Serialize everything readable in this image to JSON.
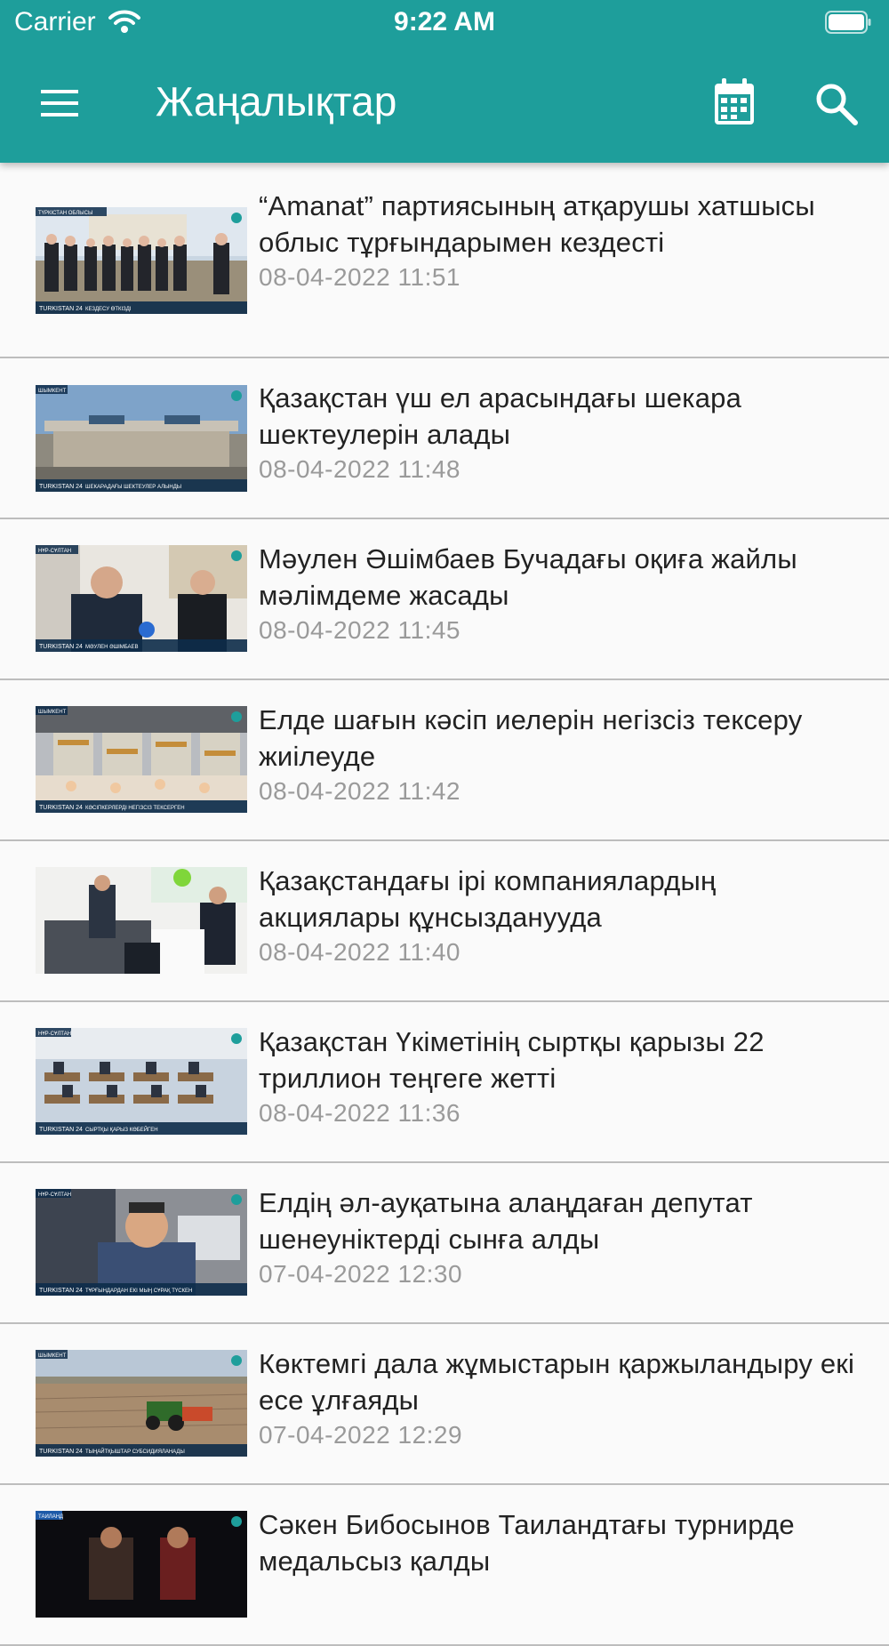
{
  "status_bar": {
    "carrier": "Carrier",
    "time": "9:22 AM"
  },
  "toolbar": {
    "title": "Жаңалықтар"
  },
  "colors": {
    "appbar": "#1e9e9b",
    "date": "#9a9a9a",
    "divider": "#bdbdbd"
  },
  "news": [
    {
      "title": "“Amanat” партиясының атқарушы хатшысы облыс тұрғындарымен кездесті",
      "date": "08-04-2022 11:51",
      "thumb_caption": "КЕЗДЕСУ ӨТКІЗДІ",
      "thumb_tag": "ТҮРКІСТАН ОБЛЫСЫ",
      "thumb_brand": "TURKISTAN 24"
    },
    {
      "title": "Қазақстан үш ел арасындағы шекара шектеулерін алады",
      "date": "08-04-2022 11:48",
      "thumb_caption": "ШЕКАРАДАҒЫ ШЕКТЕУЛЕР АЛЫНДЫ",
      "thumb_tag": "ШЫМКЕНТ",
      "thumb_brand": "TURKISTAN 24"
    },
    {
      "title": "Мәулен Әшімбаев Бучадағы оқиға жайлы мәлімдеме жасады",
      "date": "08-04-2022 11:45",
      "thumb_caption": "МӘУЛЕН ӘШІМБАЕВ",
      "thumb_tag": "НҰР-СҰЛТАН",
      "thumb_brand": "TURKISTAN 24"
    },
    {
      "title": "Елде шағын кәсіп иелерін негізсіз тексеру жиілеуде",
      "date": "08-04-2022 11:42",
      "thumb_caption": "КӘСІПКЕРЛЕРДІ НЕГІЗСІЗ ТЕКСЕРГЕН",
      "thumb_tag": "ШЫМКЕНТ",
      "thumb_brand": "TURKISTAN 24"
    },
    {
      "title": "Қазақстандағы ірі компаниялардың акциялары құнсызданууда",
      "date": "08-04-2022 11:40",
      "thumb_caption": "",
      "thumb_tag": "",
      "thumb_brand": ""
    },
    {
      "title": "Қазақстан Үкіметінің сыртқы қарызы 22 триллион теңгеге жетті",
      "date": "08-04-2022 11:36",
      "thumb_caption": "СЫРТҚЫ ҚАРЫЗ КӨБЕЙГЕН",
      "thumb_tag": "НҰР-СҰЛТАН",
      "thumb_brand": "TURKISTAN 24"
    },
    {
      "title": "Елдің әл-ауқатына алаңдаған депутат шенеуніктерді сынға алды",
      "date": "07-04-2022 12:30",
      "thumb_caption": "ТҰРҒЫНДАРДАН ЕКІ МЫҢ СҰРАҚ ТҮСКЕН",
      "thumb_tag": "НҰР-СҰЛТАН",
      "thumb_brand": "TURKISTAN 24"
    },
    {
      "title": "Көктемгі дала жұмыстарын қаржыландыру екі есе ұлғаяды",
      "date": "07-04-2022 12:29",
      "thumb_caption": "ТЫҢАЙТҚЫШТАР СУБСИДИЯЛАНАДЫ",
      "thumb_tag": "ШЫМКЕНТ",
      "thumb_brand": "TURKISTAN 24"
    },
    {
      "title": "Сәкен Бибосынов Таиландтағы турнирде медальсыз қалды",
      "date": "",
      "thumb_caption": "",
      "thumb_tag": "ТАИЛАНД",
      "thumb_brand": ""
    }
  ]
}
